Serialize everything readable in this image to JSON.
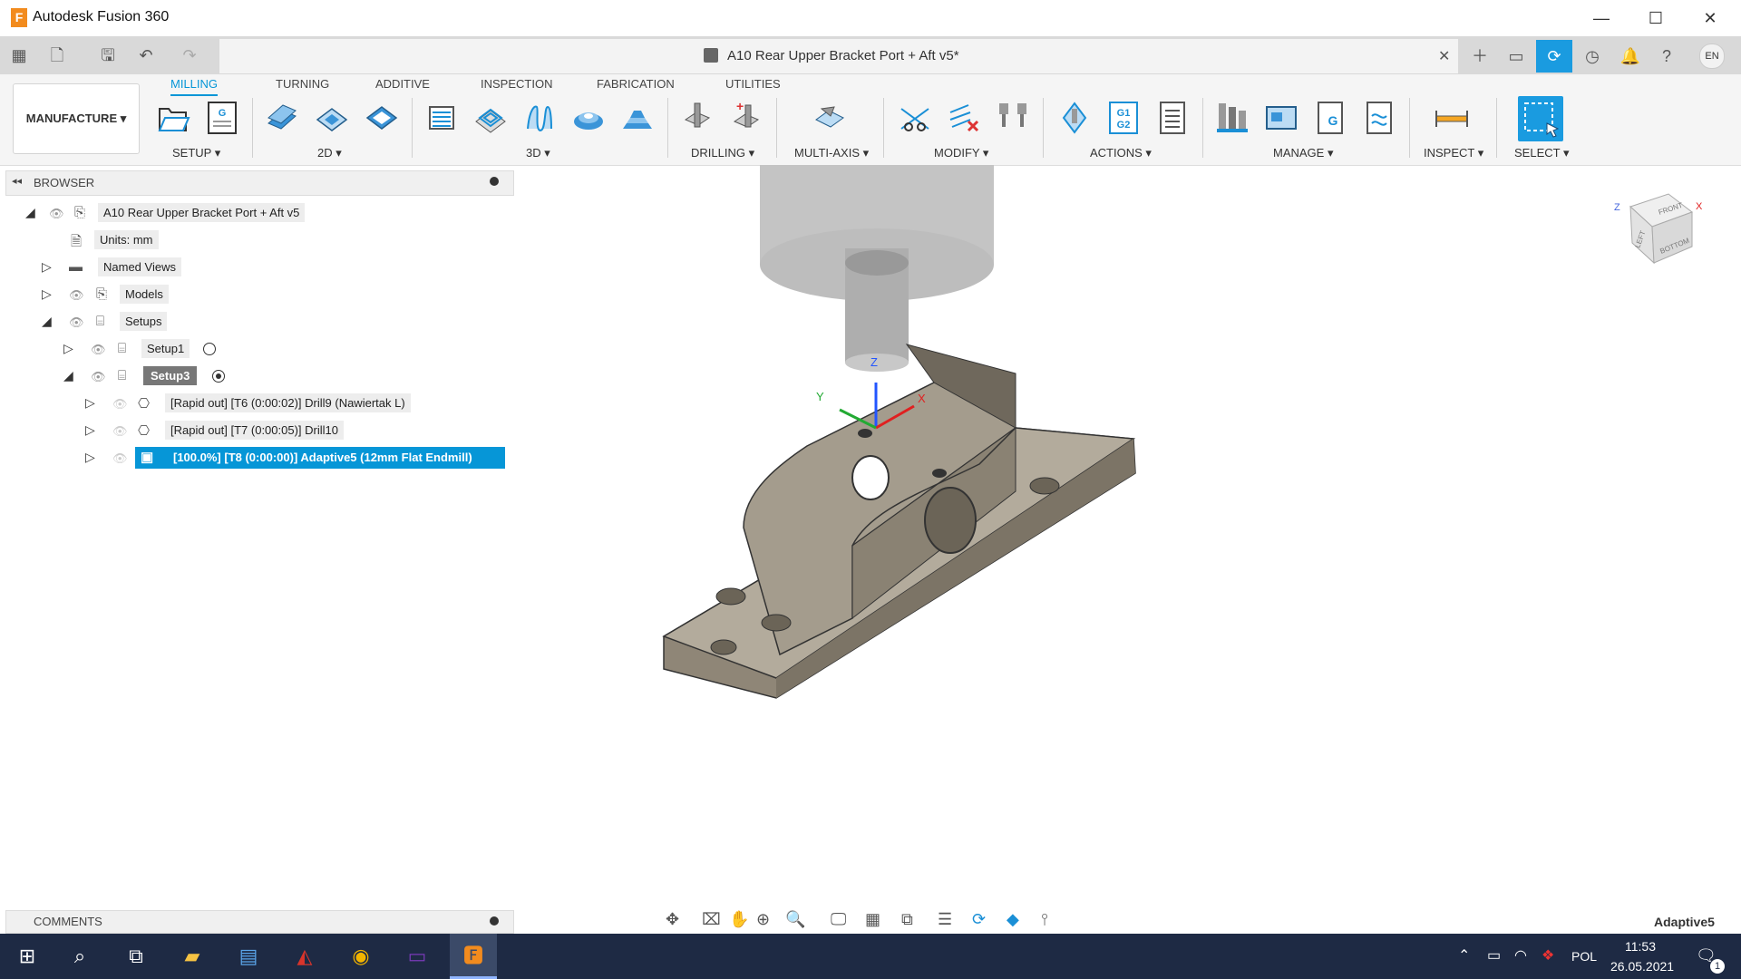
{
  "window": {
    "app_title": "Autodesk Fusion 360",
    "logo_letter": "F",
    "minimize_glyph": "—",
    "maximize_glyph": "☐",
    "close_glyph": "✕"
  },
  "document": {
    "title": "A10 Rear Upper Bracket Port + Aft v5*",
    "close_glyph": "✕",
    "user_initials": "EN"
  },
  "workspace": {
    "label": "MANUFACTURE ▾"
  },
  "ribbon": {
    "tabs": [
      "MILLING",
      "TURNING",
      "ADDITIVE",
      "INSPECTION",
      "FABRICATION",
      "UTILITIES"
    ],
    "active_tab": "MILLING",
    "groups": [
      "SETUP ▾",
      "2D ▾",
      "3D ▾",
      "DRILLING ▾",
      "MULTI-AXIS ▾",
      "MODIFY ▾",
      "ACTIONS ▾",
      "MANAGE ▾",
      "INSPECT ▾",
      "SELECT ▾"
    ],
    "g1g2_label": "G1\nG2",
    "nc_label": "G"
  },
  "browser": {
    "header": "BROWSER",
    "collapse_glyph": "◂◂",
    "items": [
      {
        "label": "A10 Rear Upper Bracket Port + Aft v5"
      },
      {
        "label": "Units: mm"
      },
      {
        "label": "Named Views"
      },
      {
        "label": "Models"
      },
      {
        "label": "Setups"
      },
      {
        "label": "Setup1"
      },
      {
        "label": "Setup3"
      },
      {
        "label": "[Rapid out] [T6 (0:00:02)] Drill9 (Nawiertak L)"
      },
      {
        "label": "[Rapid out] [T7 (0:00:05)] Drill10"
      },
      {
        "label": "[100.0%] [T8 (0:00:00)] Adaptive5 (12mm Flat Endmill)"
      }
    ]
  },
  "comments": {
    "label": "COMMENTS"
  },
  "viewport": {
    "axis_x": "X",
    "axis_y": "Y",
    "axis_z": "Z",
    "viewcube": {
      "front": "FRONT",
      "left": "LEFT",
      "bottom": "BOTTOM",
      "z": "Z",
      "x": "X"
    }
  },
  "status": {
    "operation": "Adaptive5"
  },
  "taskbar": {
    "language": "POL",
    "time": "11:53",
    "date": "26.05.2021",
    "notif_count": "1"
  }
}
